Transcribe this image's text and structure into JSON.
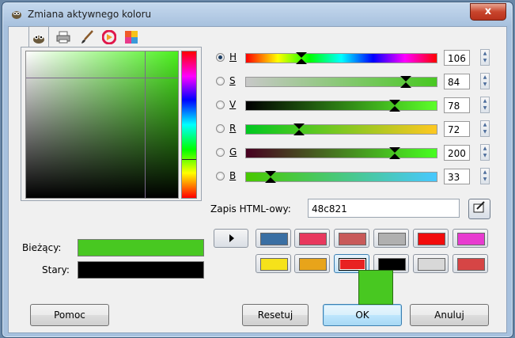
{
  "window": {
    "title": "Zmiana aktywnego koloru",
    "close_label": "x"
  },
  "notebook": {
    "tabs": [
      "gimp-icon",
      "printer-icon",
      "brush-icon",
      "color-wheel-icon",
      "palette-icon"
    ],
    "active_tab": 0
  },
  "color": {
    "current_hex": "#48c821",
    "old_hex": "#000000"
  },
  "labels": {
    "current": "Bieżący:",
    "old": "Stary:",
    "html": "Zapis HTML-owy:"
  },
  "sliders": [
    {
      "label": "H",
      "value": "106",
      "selected": true,
      "marker": 0.29
    },
    {
      "label": "S",
      "value": "84",
      "selected": false,
      "marker": 0.84
    },
    {
      "label": "V",
      "value": "78",
      "selected": false,
      "marker": 0.78
    },
    {
      "label": "R",
      "value": "72",
      "selected": false,
      "marker": 0.28
    },
    {
      "label": "G",
      "value": "200",
      "selected": false,
      "marker": 0.78
    },
    {
      "label": "B",
      "value": "33",
      "selected": false,
      "marker": 0.13
    }
  ],
  "html_value": "48c821",
  "history": [
    "#3a6fa3",
    "#e8385e",
    "#c85a5a",
    "#b0b0b0",
    "#f20c0c",
    "#e83bd0",
    "#f6e21a",
    "#e8a41a",
    "#e82222",
    "#000000",
    "#d8d8d8",
    "#d64545"
  ],
  "buttons": {
    "help": "Pomoc",
    "reset": "Resetuj",
    "ok": "OK",
    "cancel": "Anuluj"
  }
}
